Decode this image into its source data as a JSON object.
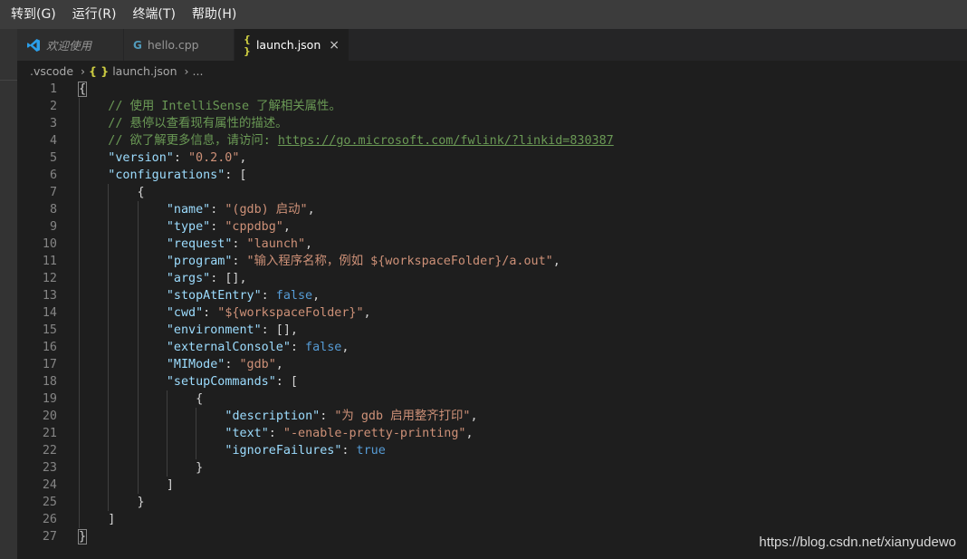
{
  "menubar": {
    "items": [
      "转到(G)",
      "运行(R)",
      "终端(T)",
      "帮助(H)"
    ]
  },
  "tabs": [
    {
      "label": "欢迎使用",
      "icon": "vscode-logo-icon",
      "italic": true,
      "active": false
    },
    {
      "label": "hello.cpp",
      "icon": "cpp-file-icon",
      "italic": false,
      "active": false
    },
    {
      "label": "launch.json",
      "icon": "json-file-icon",
      "italic": false,
      "active": true,
      "close": "×"
    }
  ],
  "breadcrumb": {
    "folder": ".vscode",
    "json_mark": "{ }",
    "file": "launch.json",
    "more": "..."
  },
  "colors": {
    "editor_bg": "#1e1e1e",
    "comment": "#6a9955",
    "key": "#9cdcfe",
    "string": "#ce9178",
    "keyword": "#569cd6",
    "line_number": "#858585"
  },
  "code_lines": [
    {
      "n": "1",
      "indent": 0,
      "tokens": [
        [
          "pun",
          "{"
        ]
      ]
    },
    {
      "n": "2",
      "indent": 1,
      "tokens": [
        [
          "com",
          "// 使用 IntelliSense 了解相关属性。"
        ]
      ]
    },
    {
      "n": "3",
      "indent": 1,
      "tokens": [
        [
          "com",
          "// 悬停以查看现有属性的描述。"
        ]
      ]
    },
    {
      "n": "4",
      "indent": 1,
      "tokens": [
        [
          "com",
          "// 欲了解更多信息，请访问: "
        ],
        [
          "link",
          "https://go.microsoft.com/fwlink/?linkid=830387"
        ]
      ]
    },
    {
      "n": "5",
      "indent": 1,
      "tokens": [
        [
          "key",
          "\"version\""
        ],
        [
          "pun",
          ": "
        ],
        [
          "str",
          "\"0.2.0\""
        ],
        [
          "pun",
          ","
        ]
      ]
    },
    {
      "n": "6",
      "indent": 1,
      "tokens": [
        [
          "key",
          "\"configurations\""
        ],
        [
          "pun",
          ": ["
        ]
      ]
    },
    {
      "n": "7",
      "indent": 2,
      "tokens": [
        [
          "pun",
          "{"
        ]
      ]
    },
    {
      "n": "8",
      "indent": 3,
      "tokens": [
        [
          "key",
          "\"name\""
        ],
        [
          "pun",
          ": "
        ],
        [
          "str",
          "\"(gdb) 启动\""
        ],
        [
          "pun",
          ","
        ]
      ]
    },
    {
      "n": "9",
      "indent": 3,
      "tokens": [
        [
          "key",
          "\"type\""
        ],
        [
          "pun",
          ": "
        ],
        [
          "str",
          "\"cppdbg\""
        ],
        [
          "pun",
          ","
        ]
      ]
    },
    {
      "n": "10",
      "indent": 3,
      "tokens": [
        [
          "key",
          "\"request\""
        ],
        [
          "pun",
          ": "
        ],
        [
          "str",
          "\"launch\""
        ],
        [
          "pun",
          ","
        ]
      ]
    },
    {
      "n": "11",
      "indent": 3,
      "tokens": [
        [
          "key",
          "\"program\""
        ],
        [
          "pun",
          ": "
        ],
        [
          "str",
          "\"输入程序名称，例如 ${workspaceFolder}/a.out\""
        ],
        [
          "pun",
          ","
        ]
      ]
    },
    {
      "n": "12",
      "indent": 3,
      "tokens": [
        [
          "key",
          "\"args\""
        ],
        [
          "pun",
          ": [],"
        ]
      ]
    },
    {
      "n": "13",
      "indent": 3,
      "tokens": [
        [
          "key",
          "\"stopAtEntry\""
        ],
        [
          "pun",
          ": "
        ],
        [
          "kw",
          "false"
        ],
        [
          "pun",
          ","
        ]
      ]
    },
    {
      "n": "14",
      "indent": 3,
      "tokens": [
        [
          "key",
          "\"cwd\""
        ],
        [
          "pun",
          ": "
        ],
        [
          "str",
          "\"${workspaceFolder}\""
        ],
        [
          "pun",
          ","
        ]
      ]
    },
    {
      "n": "15",
      "indent": 3,
      "tokens": [
        [
          "key",
          "\"environment\""
        ],
        [
          "pun",
          ": [],"
        ]
      ]
    },
    {
      "n": "16",
      "indent": 3,
      "tokens": [
        [
          "key",
          "\"externalConsole\""
        ],
        [
          "pun",
          ": "
        ],
        [
          "kw",
          "false"
        ],
        [
          "pun",
          ","
        ]
      ]
    },
    {
      "n": "17",
      "indent": 3,
      "tokens": [
        [
          "key",
          "\"MIMode\""
        ],
        [
          "pun",
          ": "
        ],
        [
          "str",
          "\"gdb\""
        ],
        [
          "pun",
          ","
        ]
      ]
    },
    {
      "n": "18",
      "indent": 3,
      "tokens": [
        [
          "key",
          "\"setupCommands\""
        ],
        [
          "pun",
          ": ["
        ]
      ]
    },
    {
      "n": "19",
      "indent": 4,
      "tokens": [
        [
          "pun",
          "{"
        ]
      ]
    },
    {
      "n": "20",
      "indent": 5,
      "tokens": [
        [
          "key",
          "\"description\""
        ],
        [
          "pun",
          ": "
        ],
        [
          "str",
          "\"为 gdb 启用整齐打印\""
        ],
        [
          "pun",
          ","
        ]
      ]
    },
    {
      "n": "21",
      "indent": 5,
      "tokens": [
        [
          "key",
          "\"text\""
        ],
        [
          "pun",
          ": "
        ],
        [
          "str",
          "\"-enable-pretty-printing\""
        ],
        [
          "pun",
          ","
        ]
      ]
    },
    {
      "n": "22",
      "indent": 5,
      "tokens": [
        [
          "key",
          "\"ignoreFailures\""
        ],
        [
          "pun",
          ": "
        ],
        [
          "kw",
          "true"
        ]
      ]
    },
    {
      "n": "23",
      "indent": 4,
      "tokens": [
        [
          "pun",
          "}"
        ]
      ]
    },
    {
      "n": "24",
      "indent": 3,
      "tokens": [
        [
          "pun",
          "]"
        ]
      ]
    },
    {
      "n": "25",
      "indent": 2,
      "tokens": [
        [
          "pun",
          "}"
        ]
      ]
    },
    {
      "n": "26",
      "indent": 1,
      "tokens": [
        [
          "pun",
          "]"
        ]
      ]
    },
    {
      "n": "27",
      "indent": 0,
      "tokens": [
        [
          "pun",
          "}"
        ]
      ]
    }
  ],
  "watermark": "https://blog.csdn.net/xianyudewo"
}
